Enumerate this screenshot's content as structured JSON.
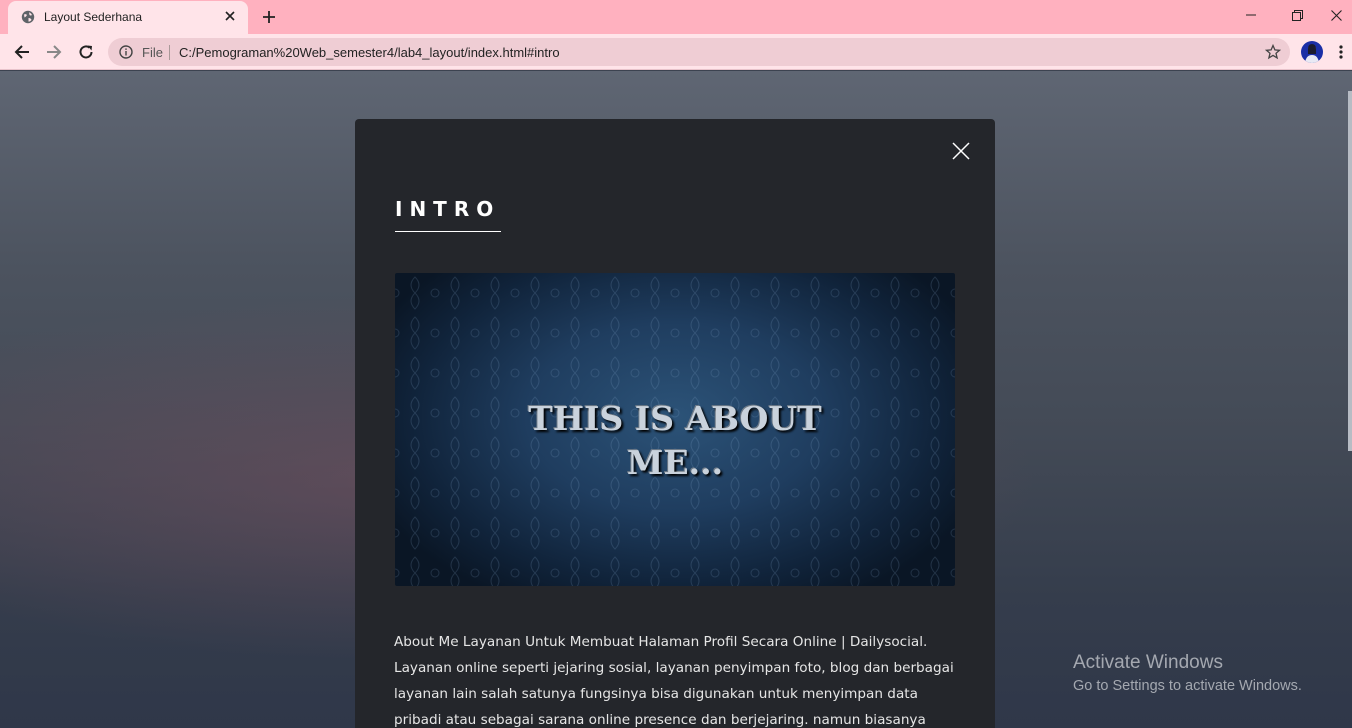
{
  "browser": {
    "tab": {
      "title": "Layout Sederhana",
      "favicon": "globe-icon"
    },
    "address_bar": {
      "scheme_label": "File",
      "url": "C:/Pemograman%20Web_semester4/lab4_layout/index.html#intro"
    },
    "icons": [
      "back-arrow-icon",
      "forward-arrow-icon",
      "reload-icon",
      "info-icon",
      "star-icon",
      "kebab-menu-icon",
      "minimize-icon",
      "restore-icon",
      "close-icon"
    ],
    "colors": {
      "titlebar": "#ffb1bf",
      "toolbar": "#ffe4e9",
      "omnibox": "#efcdd4"
    }
  },
  "modal": {
    "title": "INTRO",
    "image_text_line1": "THIS IS ABOUT",
    "image_text_line2": "ME...",
    "about_text": "About Me Layanan Untuk Membuat Halaman Profil Secara Online | Dailysocial. Layanan online seperti jejaring sosial, layanan penyimpan foto, blog dan berbagai layanan lain salah satunya fungsinya bisa digunakan untuk menyimpan data pribadi atau sebagai sarana online presence dan berjejaring. namun biasanya berbagai layanan ini terpisah-",
    "colors": {
      "background": "#24262b",
      "text": "#e6e6e6"
    }
  },
  "watermark": {
    "title": "Activate Windows",
    "subtitle": "Go to Settings to activate Windows."
  }
}
